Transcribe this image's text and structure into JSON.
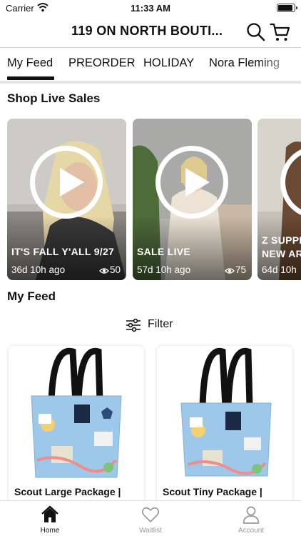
{
  "status_bar": {
    "carrier": "Carrier",
    "time": "11:33 AM"
  },
  "header": {
    "title": "119 ON NORTH BOUTI..."
  },
  "tabs": [
    {
      "label": "My Feed",
      "active": true
    },
    {
      "label": "PREORDER",
      "active": false
    },
    {
      "label": "HOLIDAY",
      "active": false
    },
    {
      "label": "Nora Fleming",
      "active": false
    }
  ],
  "live_sales": {
    "title": "Shop Live Sales",
    "items": [
      {
        "title": "IT'S FALL Y'ALL 9/27",
        "ago": "36d 10h ago",
        "views": "50"
      },
      {
        "title": "SALE LIVE",
        "ago": "57d 10h ago",
        "views": "75"
      },
      {
        "title_line1": "Z SUPPLY",
        "title_line2": "NEW AR",
        "ago": "64d 10h"
      }
    ]
  },
  "feed": {
    "title": "My Feed",
    "filter_label": "Filter",
    "products": [
      {
        "name": "Scout Large Package |"
      },
      {
        "name": "Scout Tiny Package |"
      }
    ]
  },
  "bottom_nav": [
    {
      "label": "Home",
      "icon": "home-icon",
      "active": true
    },
    {
      "label": "Waitlist",
      "icon": "heart-icon",
      "active": false
    },
    {
      "label": "Account",
      "icon": "person-icon",
      "active": false
    }
  ],
  "colors": {
    "accent": "#111111",
    "inactive": "#9a9a9a",
    "bag_blue": "#9ec8ea"
  }
}
